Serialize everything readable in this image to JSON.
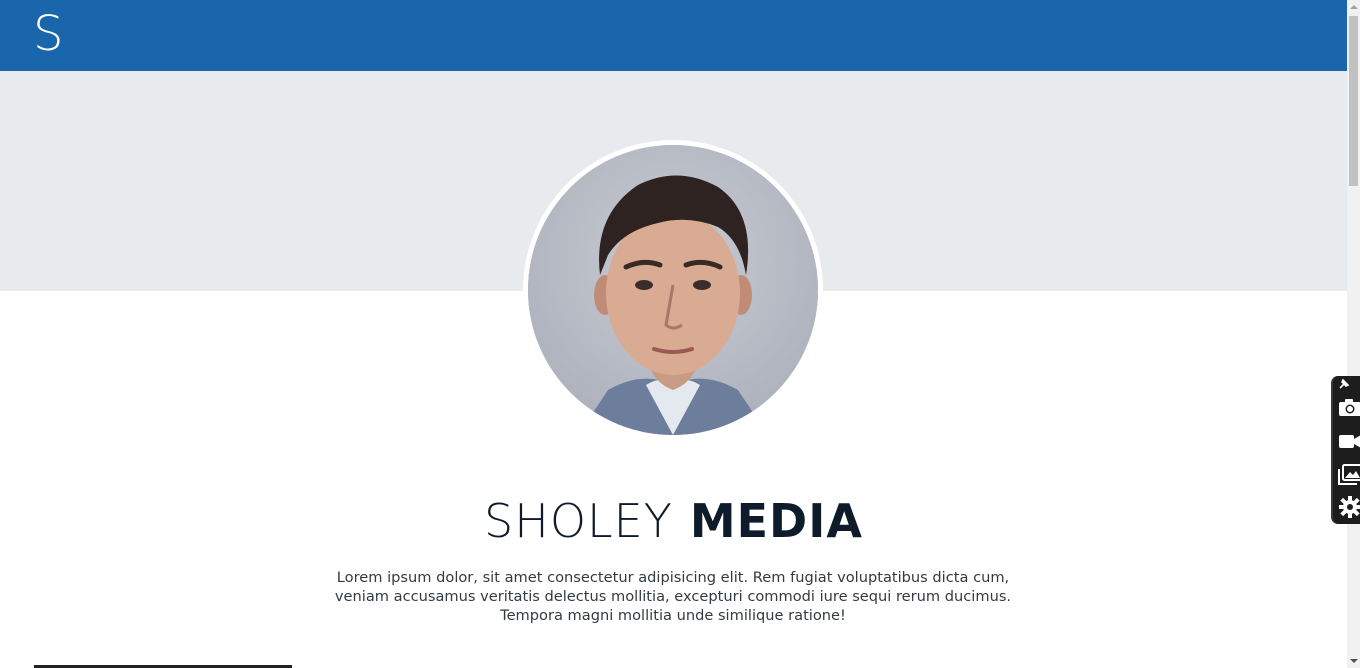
{
  "header": {
    "logo": "S",
    "background_color": "#1a66ad"
  },
  "hero": {
    "band_color": "#e8ebee",
    "avatar_icon": "profile-photo"
  },
  "main": {
    "title_light": "SHOLEY",
    "title_bold": "MEDIA",
    "lead": "Lorem ipsum dolor, sit amet consectetur adipisicing elit. Rem fugiat voluptatibus dicta cum, veniam accusamus veritatis delectus mollitia, excepturi commodi iure sequi rerum ducimus. Tempora magni mollitia unde similique ratione!"
  },
  "tool_panel": {
    "tools": [
      {
        "icon": "pin-icon"
      },
      {
        "icon": "camera-icon"
      },
      {
        "icon": "video-camera-icon"
      },
      {
        "icon": "gallery-icon"
      },
      {
        "icon": "gear-icon"
      }
    ]
  }
}
